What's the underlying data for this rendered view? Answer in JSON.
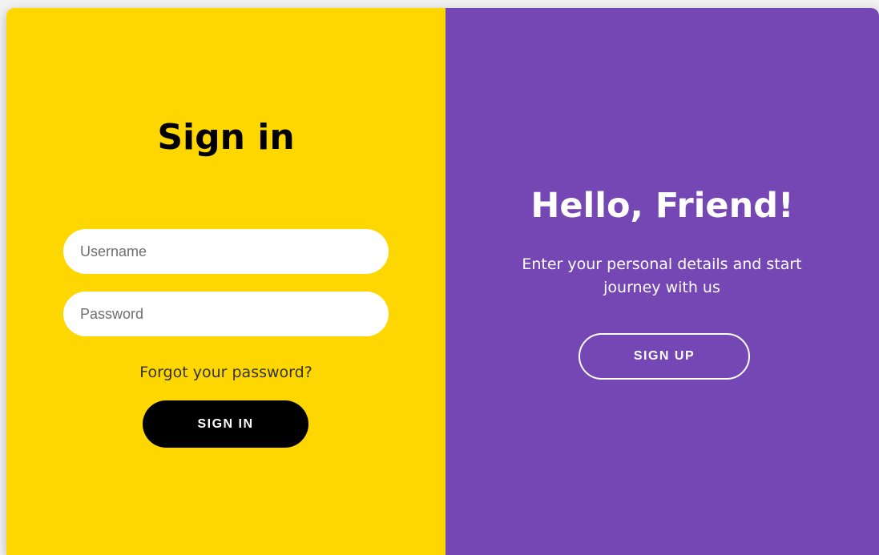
{
  "colors": {
    "left_panel_bg": "#ffd700",
    "right_panel_bg": "#7547b5",
    "primary_button_bg": "#000000",
    "text_dark": "#000000",
    "text_light": "#ffffff"
  },
  "signin_panel": {
    "title": "Sign in",
    "username": {
      "placeholder": "Username",
      "value": ""
    },
    "password": {
      "placeholder": "Password",
      "value": ""
    },
    "forgot_link": "Forgot your password?",
    "signin_button": "SIGN IN"
  },
  "overlay_panel": {
    "title": "Hello, Friend!",
    "subtitle": "Enter your personal details and start journey with us",
    "signup_button": "SIGN UP"
  }
}
